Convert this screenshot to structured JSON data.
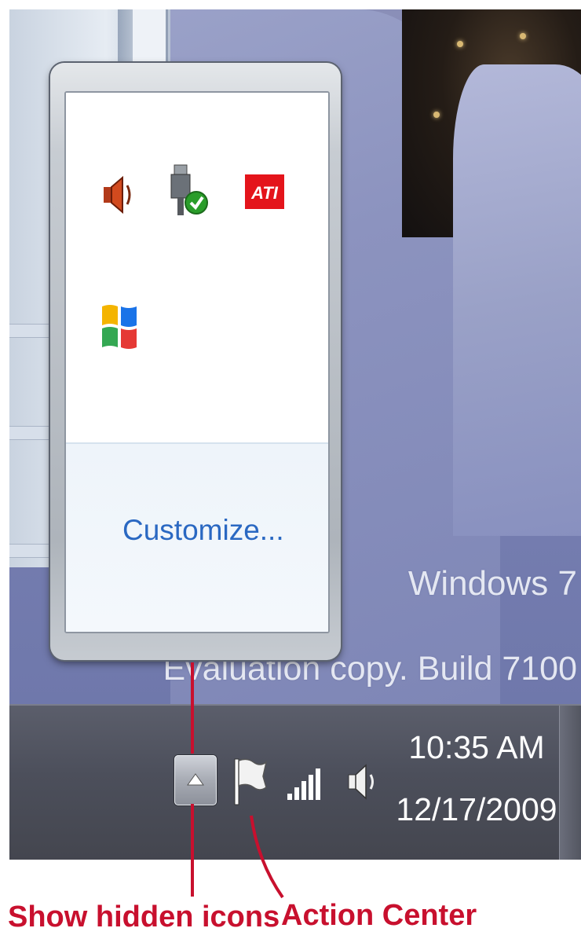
{
  "desktop": {
    "watermark_line1": "Windows 7",
    "watermark_line2": "Evaluation copy. Build 7100"
  },
  "overflow_popup": {
    "icons": [
      {
        "name": "volume-icon"
      },
      {
        "name": "safely-remove-hardware-icon"
      },
      {
        "name": "ati-catalyst-icon",
        "text": "ATI"
      },
      {
        "name": "windows-flag-icon"
      }
    ],
    "customize_link": "Customize..."
  },
  "taskbar": {
    "notification_icons": [
      "action-center-flag-icon",
      "network-signal-icon",
      "speaker-icon"
    ],
    "clock": {
      "time": "10:35 AM",
      "date": "12/17/2009"
    }
  },
  "annotations": {
    "show_hidden_icons": "Show hidden icons",
    "action_center": "Action Center"
  },
  "colors": {
    "annotation": "#c8102e",
    "link": "#2a68c2",
    "taskbar": "#4c4f5b"
  }
}
